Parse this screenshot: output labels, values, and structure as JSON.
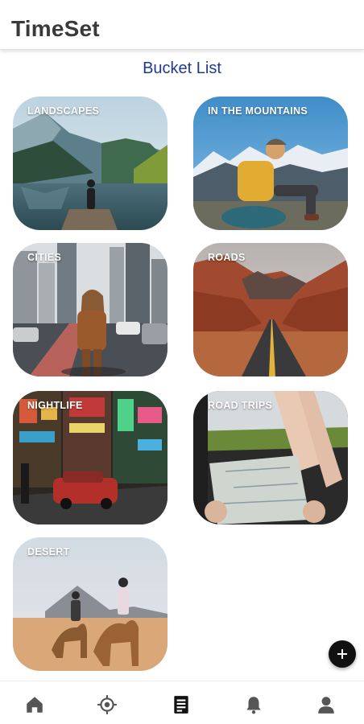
{
  "app": {
    "title": "TimeSet"
  },
  "page": {
    "section_title": "Bucket List"
  },
  "cards": [
    {
      "label": "LANDSCAPES"
    },
    {
      "label": "IN THE MOUNTAINS"
    },
    {
      "label": "CITIES"
    },
    {
      "label": "ROADS"
    },
    {
      "label": "NIGHTLIFE"
    },
    {
      "label": "ROAD TRIPS"
    },
    {
      "label": "DESERT"
    }
  ],
  "fab": {
    "icon": "plus-icon"
  },
  "bottom_nav": {
    "items": [
      {
        "icon": "home-icon",
        "active": false
      },
      {
        "icon": "location-target-icon",
        "active": false
      },
      {
        "icon": "list-document-icon",
        "active": true
      },
      {
        "icon": "bell-icon",
        "active": false
      },
      {
        "icon": "person-icon",
        "active": false
      }
    ],
    "inactive_color": "#555555",
    "active_color": "#111111"
  }
}
